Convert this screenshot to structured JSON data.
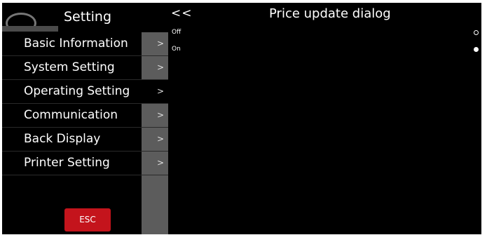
{
  "sidebar": {
    "title": "Setting",
    "items": [
      {
        "label": "Basic Information",
        "arrow": ">"
      },
      {
        "label": "System Setting",
        "arrow": ">"
      },
      {
        "label": "Operating Setting",
        "arrow": ">"
      },
      {
        "label": "Communication",
        "arrow": ">"
      },
      {
        "label": "Back Display",
        "arrow": ">"
      },
      {
        "label": "Printer Setting",
        "arrow": ">"
      }
    ],
    "active_item": "Operating Setting",
    "esc_label": "ESC"
  },
  "main": {
    "back_label": "<<",
    "title": "Price update dialog",
    "options": [
      {
        "label": "Off",
        "selected": false
      },
      {
        "label": "On",
        "selected": true
      }
    ]
  },
  "colors": {
    "background": "#000000",
    "arrow_column": "#5c5c5c",
    "esc_button": "#c4141c",
    "text": "#ffffff"
  }
}
